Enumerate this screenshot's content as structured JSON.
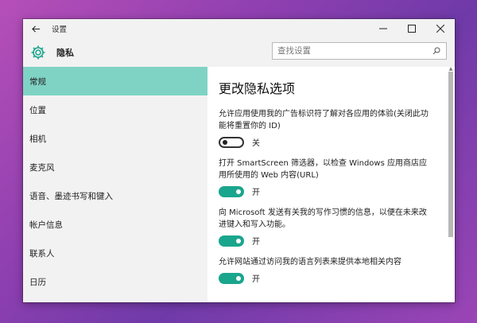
{
  "window": {
    "title": "设置"
  },
  "header": {
    "page_name": "隐私",
    "search_placeholder": "查找设置"
  },
  "sidebar": {
    "items": [
      {
        "label": "常规",
        "active": true
      },
      {
        "label": "位置",
        "active": false
      },
      {
        "label": "相机",
        "active": false
      },
      {
        "label": "麦克风",
        "active": false
      },
      {
        "label": "语音、墨迹书写和键入",
        "active": false
      },
      {
        "label": "帐户信息",
        "active": false
      },
      {
        "label": "联系人",
        "active": false
      },
      {
        "label": "日历",
        "active": false
      }
    ]
  },
  "main": {
    "title": "更改隐私选项",
    "settings": [
      {
        "description": "允许应用使用我的广告标识符了解对各应用的体验(关闭此功能将重置你的 ID)",
        "state": "关",
        "on": false
      },
      {
        "description": "打开 SmartScreen 筛选器，以检查 Windows 应用商店应用所使用的 Web 内容(URL)",
        "state": "开",
        "on": true
      },
      {
        "description": "向 Microsoft 发送有关我的写作习惯的信息，以便在未来改进键入和写入功能。",
        "state": "开",
        "on": true
      },
      {
        "description": "允许网站通过访问我的语言列表来提供本地相关内容",
        "state": "开",
        "on": true
      }
    ]
  },
  "colors": {
    "accent": "#1aa58d",
    "sidebar_active": "#7fd3c4"
  }
}
